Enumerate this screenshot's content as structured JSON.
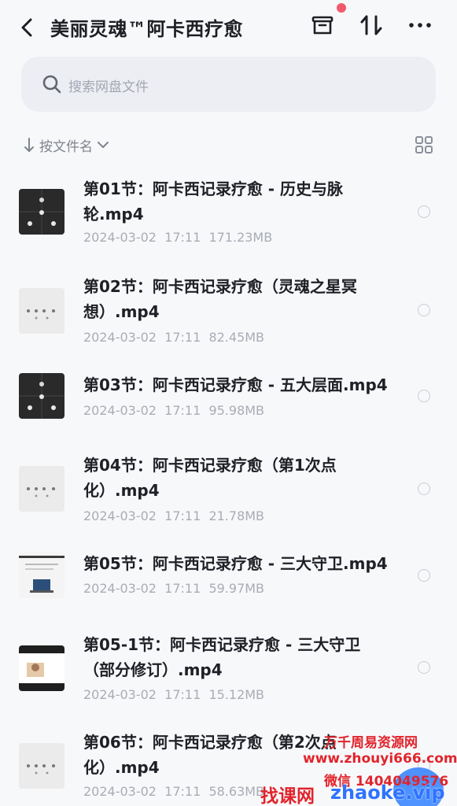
{
  "header": {
    "title": "美丽灵魂™阿卡西疗愈"
  },
  "search": {
    "placeholder": "搜索网盘文件"
  },
  "sort": {
    "label": "按文件名"
  },
  "files": [
    {
      "name": "第01节：阿卡西记录疗愈 - 历史与脉轮.mp4",
      "date": "2024-03-02",
      "time": "17:11",
      "size": "171.23MB",
      "thumb": "dark-grid"
    },
    {
      "name": "第02节：阿卡西记录疗愈（灵魂之星冥想）.mp4",
      "date": "2024-03-02",
      "time": "17:11",
      "size": "82.45MB",
      "thumb": "light-dots"
    },
    {
      "name": "第03节：阿卡西记录疗愈 - 五大层面.mp4",
      "date": "2024-03-02",
      "time": "17:11",
      "size": "95.98MB",
      "thumb": "dark-grid"
    },
    {
      "name": "第04节：阿卡西记录疗愈（第1次点化）.mp4",
      "date": "2024-03-02",
      "time": "17:11",
      "size": "21.78MB",
      "thumb": "light-dots"
    },
    {
      "name": "第05节：阿卡西记录疗愈 - 三大守卫.mp4",
      "date": "2024-03-02",
      "time": "17:11",
      "size": "59.97MB",
      "thumb": "screen"
    },
    {
      "name": "第05-1节：阿卡西记录疗愈 - 三大守卫（部分修订）.mp4",
      "date": "2024-03-02",
      "time": "17:11",
      "size": "15.12MB",
      "thumb": "video-call"
    },
    {
      "name": "第06节：阿卡西记录疗愈（第2次点化）.mp4",
      "date": "2024-03-02",
      "time": "17:11",
      "size": "58.63MB",
      "thumb": "light-dots"
    }
  ],
  "watermark": {
    "line1": "万千周易资源网",
    "line2": "www.zhouyi666.com",
    "line3": "微信 1404049576",
    "brand_cn": "找课网",
    "brand_url": "zhaoke.vip"
  },
  "colors": {
    "notification_dot": "#f25a6b",
    "watermark_red": "#e1242b",
    "watermark_blue": "#2f73ff"
  }
}
